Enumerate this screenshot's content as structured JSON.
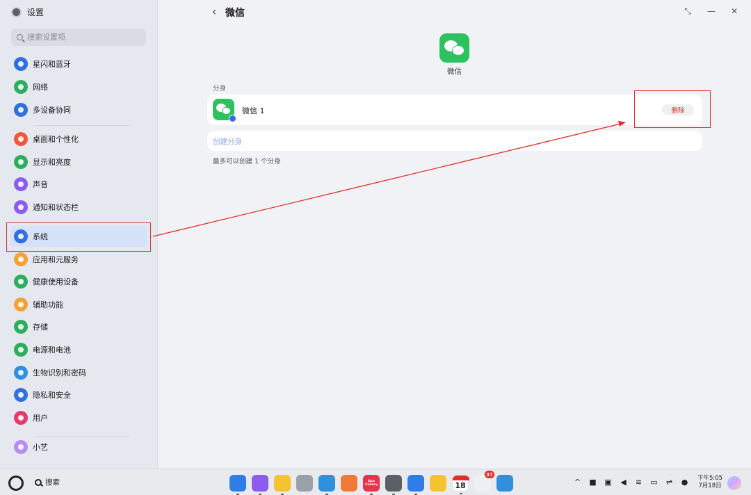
{
  "app": {
    "title": "设置"
  },
  "search": {
    "placeholder": "搜索设置项"
  },
  "sidebar": {
    "items": [
      {
        "label": "星闪和蓝牙",
        "icon": "bluetooth-icon",
        "color": "#2f6fe0"
      },
      {
        "label": "网络",
        "icon": "globe-icon",
        "color": "#2dae5f"
      },
      {
        "label": "多设备协同",
        "icon": "multi-device-icon",
        "color": "#2f6fe0"
      },
      {
        "label": "桌面和个性化",
        "icon": "desktop-icon",
        "color": "#f0563a"
      },
      {
        "label": "显示和亮度",
        "icon": "eye-icon",
        "color": "#2dae5f"
      },
      {
        "label": "声音",
        "icon": "speaker-icon",
        "color": "#8c5cf0"
      },
      {
        "label": "通知和状态栏",
        "icon": "bell-icon",
        "color": "#8c5cf0"
      },
      {
        "label": "系统",
        "icon": "gear-icon",
        "color": "#2f6fe0"
      },
      {
        "label": "应用和元服务",
        "icon": "apps-grid-icon",
        "color": "#f4a233"
      },
      {
        "label": "健康使用设备",
        "icon": "hourglass-icon",
        "color": "#2dae5f"
      },
      {
        "label": "辅助功能",
        "icon": "hand-icon",
        "color": "#f4a233"
      },
      {
        "label": "存储",
        "icon": "storage-icon",
        "color": "#2dae5f"
      },
      {
        "label": "电源和电池",
        "icon": "battery-icon",
        "color": "#2dae5f"
      },
      {
        "label": "生物识别和密码",
        "icon": "key-icon",
        "color": "#2f8fe0"
      },
      {
        "label": "隐私和安全",
        "icon": "shield-icon",
        "color": "#2f6fe0"
      },
      {
        "label": "用户",
        "icon": "user-icon",
        "color": "#e83a6a"
      },
      {
        "label": "小艺",
        "icon": "assistant-icon",
        "color": "#b88cf0"
      }
    ]
  },
  "main": {
    "title": "微信",
    "app_name": "微信",
    "section_label": "分身",
    "clone_name": "微信 1",
    "delete_label": "删除",
    "create_label": "创建分身",
    "hint": "最多可以创建 1 个分身"
  },
  "colors": {
    "accent": "#2f6fe0",
    "wechat": "#2dc160",
    "danger": "#d9352b",
    "annotation": "#e0302a"
  },
  "taskbar": {
    "search_label": "搜索",
    "dock": [
      {
        "icon": "app-center-icon",
        "color": "#2f7ee8"
      },
      {
        "icon": "multitask-icon",
        "color": "#8c5cf0"
      },
      {
        "icon": "files-icon",
        "color": "#f4c430"
      },
      {
        "icon": "trash-icon",
        "color": "#9aa0a8"
      },
      {
        "icon": "browser-icon",
        "color": "#2f8fe0"
      },
      {
        "icon": "gallery-icon",
        "color": "#f07a3a"
      },
      {
        "icon": "app-gallery-icon",
        "color": "#e8334a",
        "text": "App Gallery"
      },
      {
        "icon": "settings-icon",
        "color": "#5b5f66"
      },
      {
        "icon": "notes-icon",
        "color": "#2f7ee8"
      },
      {
        "icon": "memo-icon",
        "color": "#f4c430"
      },
      {
        "icon": "calendar-icon",
        "color": "#ffffff",
        "day": "18"
      },
      {
        "icon": "mail-icon",
        "color": "#f0f0f2",
        "badge": "37"
      },
      {
        "icon": "cloud-icon",
        "color": "#2f8fe0"
      }
    ],
    "clock": {
      "time": "下午5:05",
      "date": "7月18日"
    }
  }
}
